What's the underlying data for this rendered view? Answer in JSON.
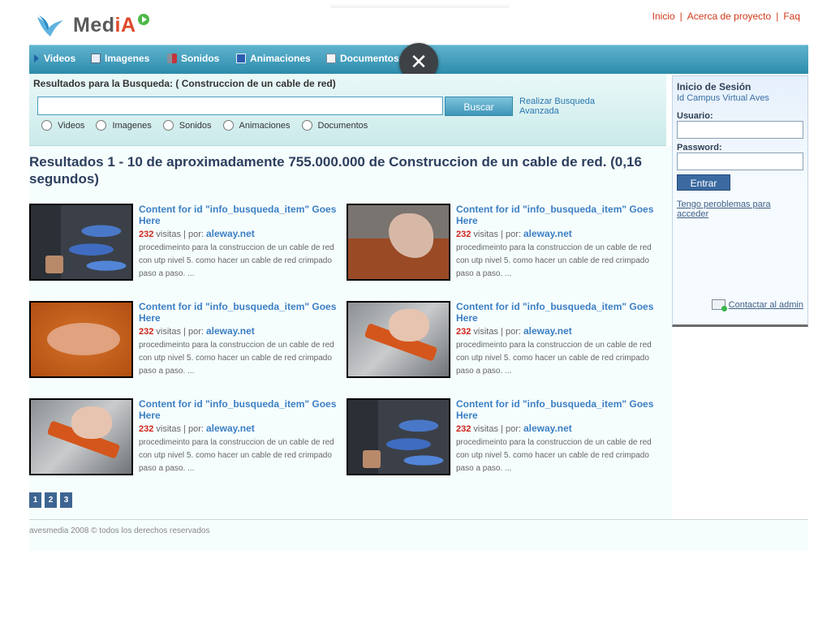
{
  "brand": {
    "name_prefix": "Med",
    "name_accent": "iA"
  },
  "top_links": [
    "Inicio",
    "Acerca de proyecto",
    "Faq"
  ],
  "nav": {
    "items": [
      {
        "label": "Videos",
        "icon": "play-icon"
      },
      {
        "label": "Imagenes",
        "icon": "image-icon"
      },
      {
        "label": "Sonidos",
        "icon": "sound-icon"
      },
      {
        "label": "Animaciones",
        "icon": "animation-icon"
      },
      {
        "label": "Documentos",
        "icon": "document-icon"
      }
    ]
  },
  "overlay": {
    "close_glyph": "✕"
  },
  "search": {
    "title": "Resultados para la Busqueda: ( Construccion de un cable de red)",
    "query_value": "",
    "button_label": "Buscar",
    "advanced_label": "Realizar Busqueda Avanzada",
    "filters": [
      "Videos",
      "Imagenes",
      "Sonidos",
      "Animaciones",
      "Documentos"
    ]
  },
  "results": {
    "heading": "Resultados 1 - 10 de aproximadamente 755.000.000 de Construccion de un cable de red. (0,16 segundos)",
    "items": [
      {
        "title": "Content for id \"info_busqueda_item\" Goes Here",
        "visits": "232",
        "visits_label": "visitas | por:",
        "source": "aleway.net",
        "description": "procedimeinto para la construccion de un cable de red con utp nivel 5. como hacer un cable de red crimpado paso a paso. ..."
      },
      {
        "title": "Content for id \"info_busqueda_item\" Goes Here",
        "visits": "232",
        "visits_label": "visitas | por:",
        "source": "aleway.net",
        "description": "procedimeinto para la construccion de un cable de red con utp nivel 5. como hacer un cable de red crimpado paso a paso. ..."
      },
      {
        "title": "Content for id \"info_busqueda_item\" Goes Here",
        "visits": "232",
        "visits_label": "visitas | por:",
        "source": "aleway.net",
        "description": "procedimeinto para la construccion de un cable de red con utp nivel 5. como hacer un cable de red crimpado paso a paso. ..."
      },
      {
        "title": "Content for id \"info_busqueda_item\" Goes Here",
        "visits": "232",
        "visits_label": "visitas | por:",
        "source": "aleway.net",
        "description": "procedimeinto para la construccion de un cable de red con utp nivel 5. como hacer un cable de red crimpado paso a paso. ..."
      },
      {
        "title": "Content for id \"info_busqueda_item\" Goes Here",
        "visits": "232",
        "visits_label": "visitas | por:",
        "source": "aleway.net",
        "description": "procedimeinto para la construccion de un cable de red con utp nivel 5. como hacer un cable de red crimpado paso a paso. ..."
      },
      {
        "title": "Content for id \"info_busqueda_item\" Goes Here",
        "visits": "232",
        "visits_label": "visitas | por:",
        "source": "aleway.net",
        "description": "procedimeinto para la construccion de un cable de red con utp nivel 5. como hacer un cable de red crimpado paso a paso. ..."
      }
    ],
    "pages": [
      "1",
      "2",
      "3"
    ]
  },
  "login": {
    "heading": "Inicio de Sesión",
    "subheading": "Id Campus Virtual Aves",
    "username_label": "Usuario:",
    "password_label": "Password:",
    "submit_label": "Entrar",
    "problem_link": "Tengo peroblemas para acceder",
    "contact_link": "Contactar al admin"
  },
  "footer": {
    "text": "avesmedia 2008 © todos los derechos reservados"
  },
  "colors": {
    "nav_top": "#5fb3cf",
    "nav_bottom": "#2d8cab",
    "link_red": "#d03a1a",
    "link_blue": "#3b7fc4",
    "heading": "#2c3f5e",
    "pager": "#3e6592"
  }
}
